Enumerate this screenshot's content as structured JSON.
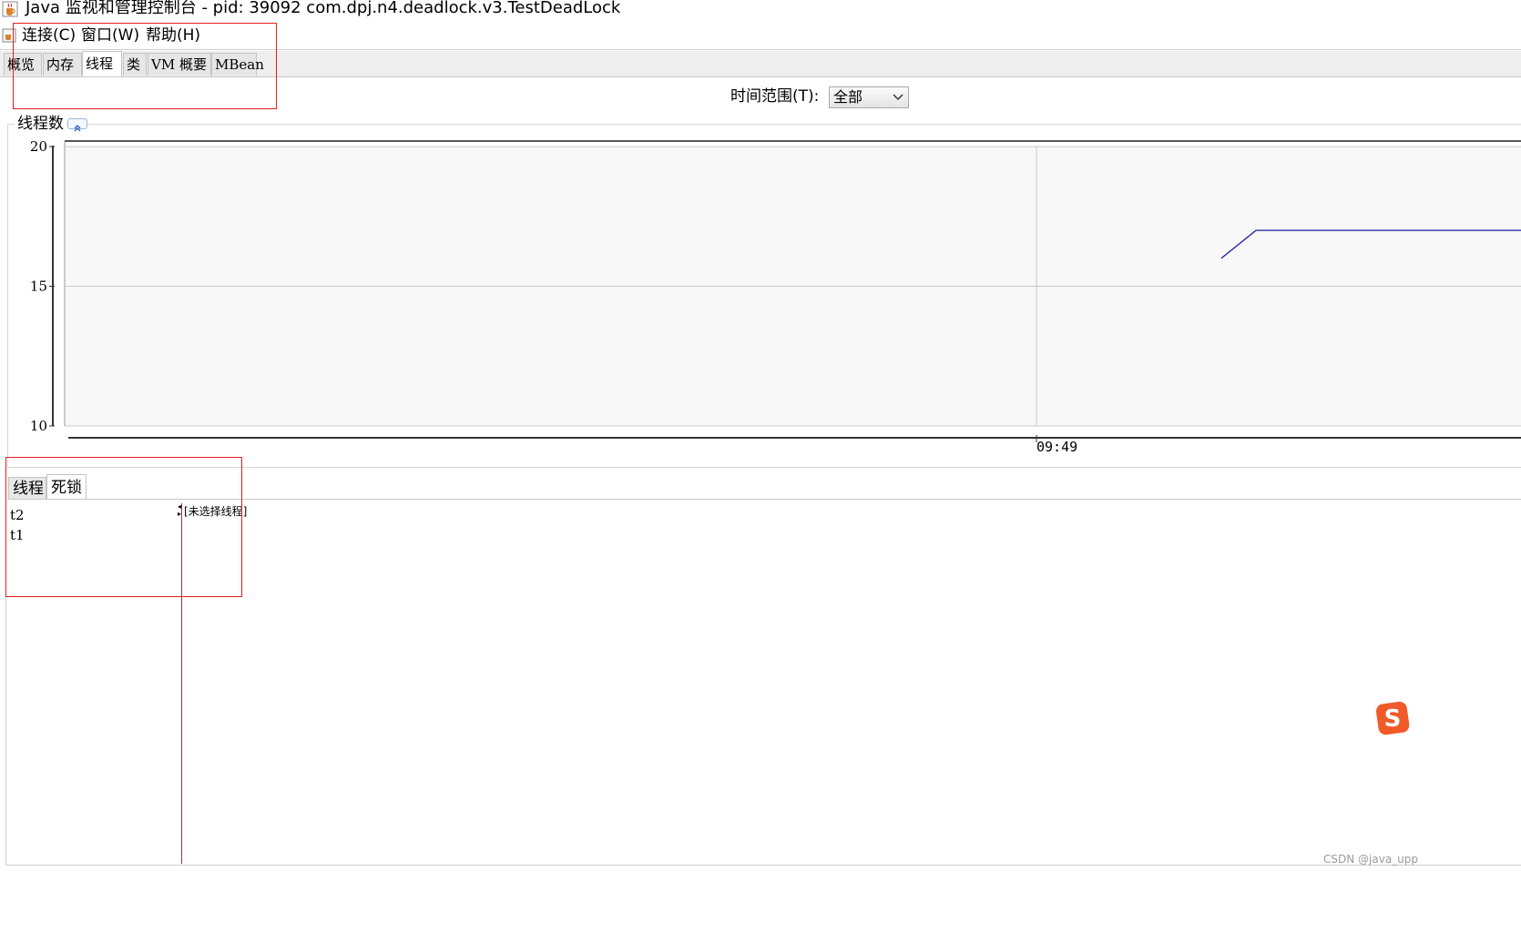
{
  "window": {
    "title": "Java 监视和管理控制台 - pid: 39092 com.dpj.n4.deadlock.v3.TestDeadLock"
  },
  "menu": {
    "items": [
      "连接(C)",
      "窗口(W)",
      "帮助(H)"
    ]
  },
  "main_tabs": {
    "items": [
      "概览",
      "内存",
      "线程",
      "类",
      "VM 概要",
      "MBean"
    ],
    "active": "线程"
  },
  "time_range": {
    "label": "时间范围(T):",
    "value": "全部"
  },
  "chart_group": {
    "title": "线程数"
  },
  "chart_data": {
    "type": "line",
    "title": "线程数",
    "y_ticks": [
      "20",
      "15",
      "10"
    ],
    "ylim": [
      10,
      20
    ],
    "x_ticks": [
      "09:49"
    ],
    "grid": true,
    "series": [
      {
        "color": "#1a1aa6",
        "points": [
          {
            "x": "09:50",
            "y": 16
          },
          {
            "x": "09:50",
            "y": 17
          },
          {
            "x": "09:51",
            "y": 17
          }
        ]
      }
    ]
  },
  "sub_tabs": {
    "items": [
      "线程",
      "死锁"
    ],
    "active": "死锁"
  },
  "threads": [
    "t2",
    "t1"
  ],
  "detail": {
    "placeholder": "[未选择线程]"
  },
  "watermark": "CSDN @java_upp",
  "colors": {
    "annotation_red": "#e02020",
    "series_blue": "#1a1aa6",
    "ime_orange": "#f05a28"
  }
}
